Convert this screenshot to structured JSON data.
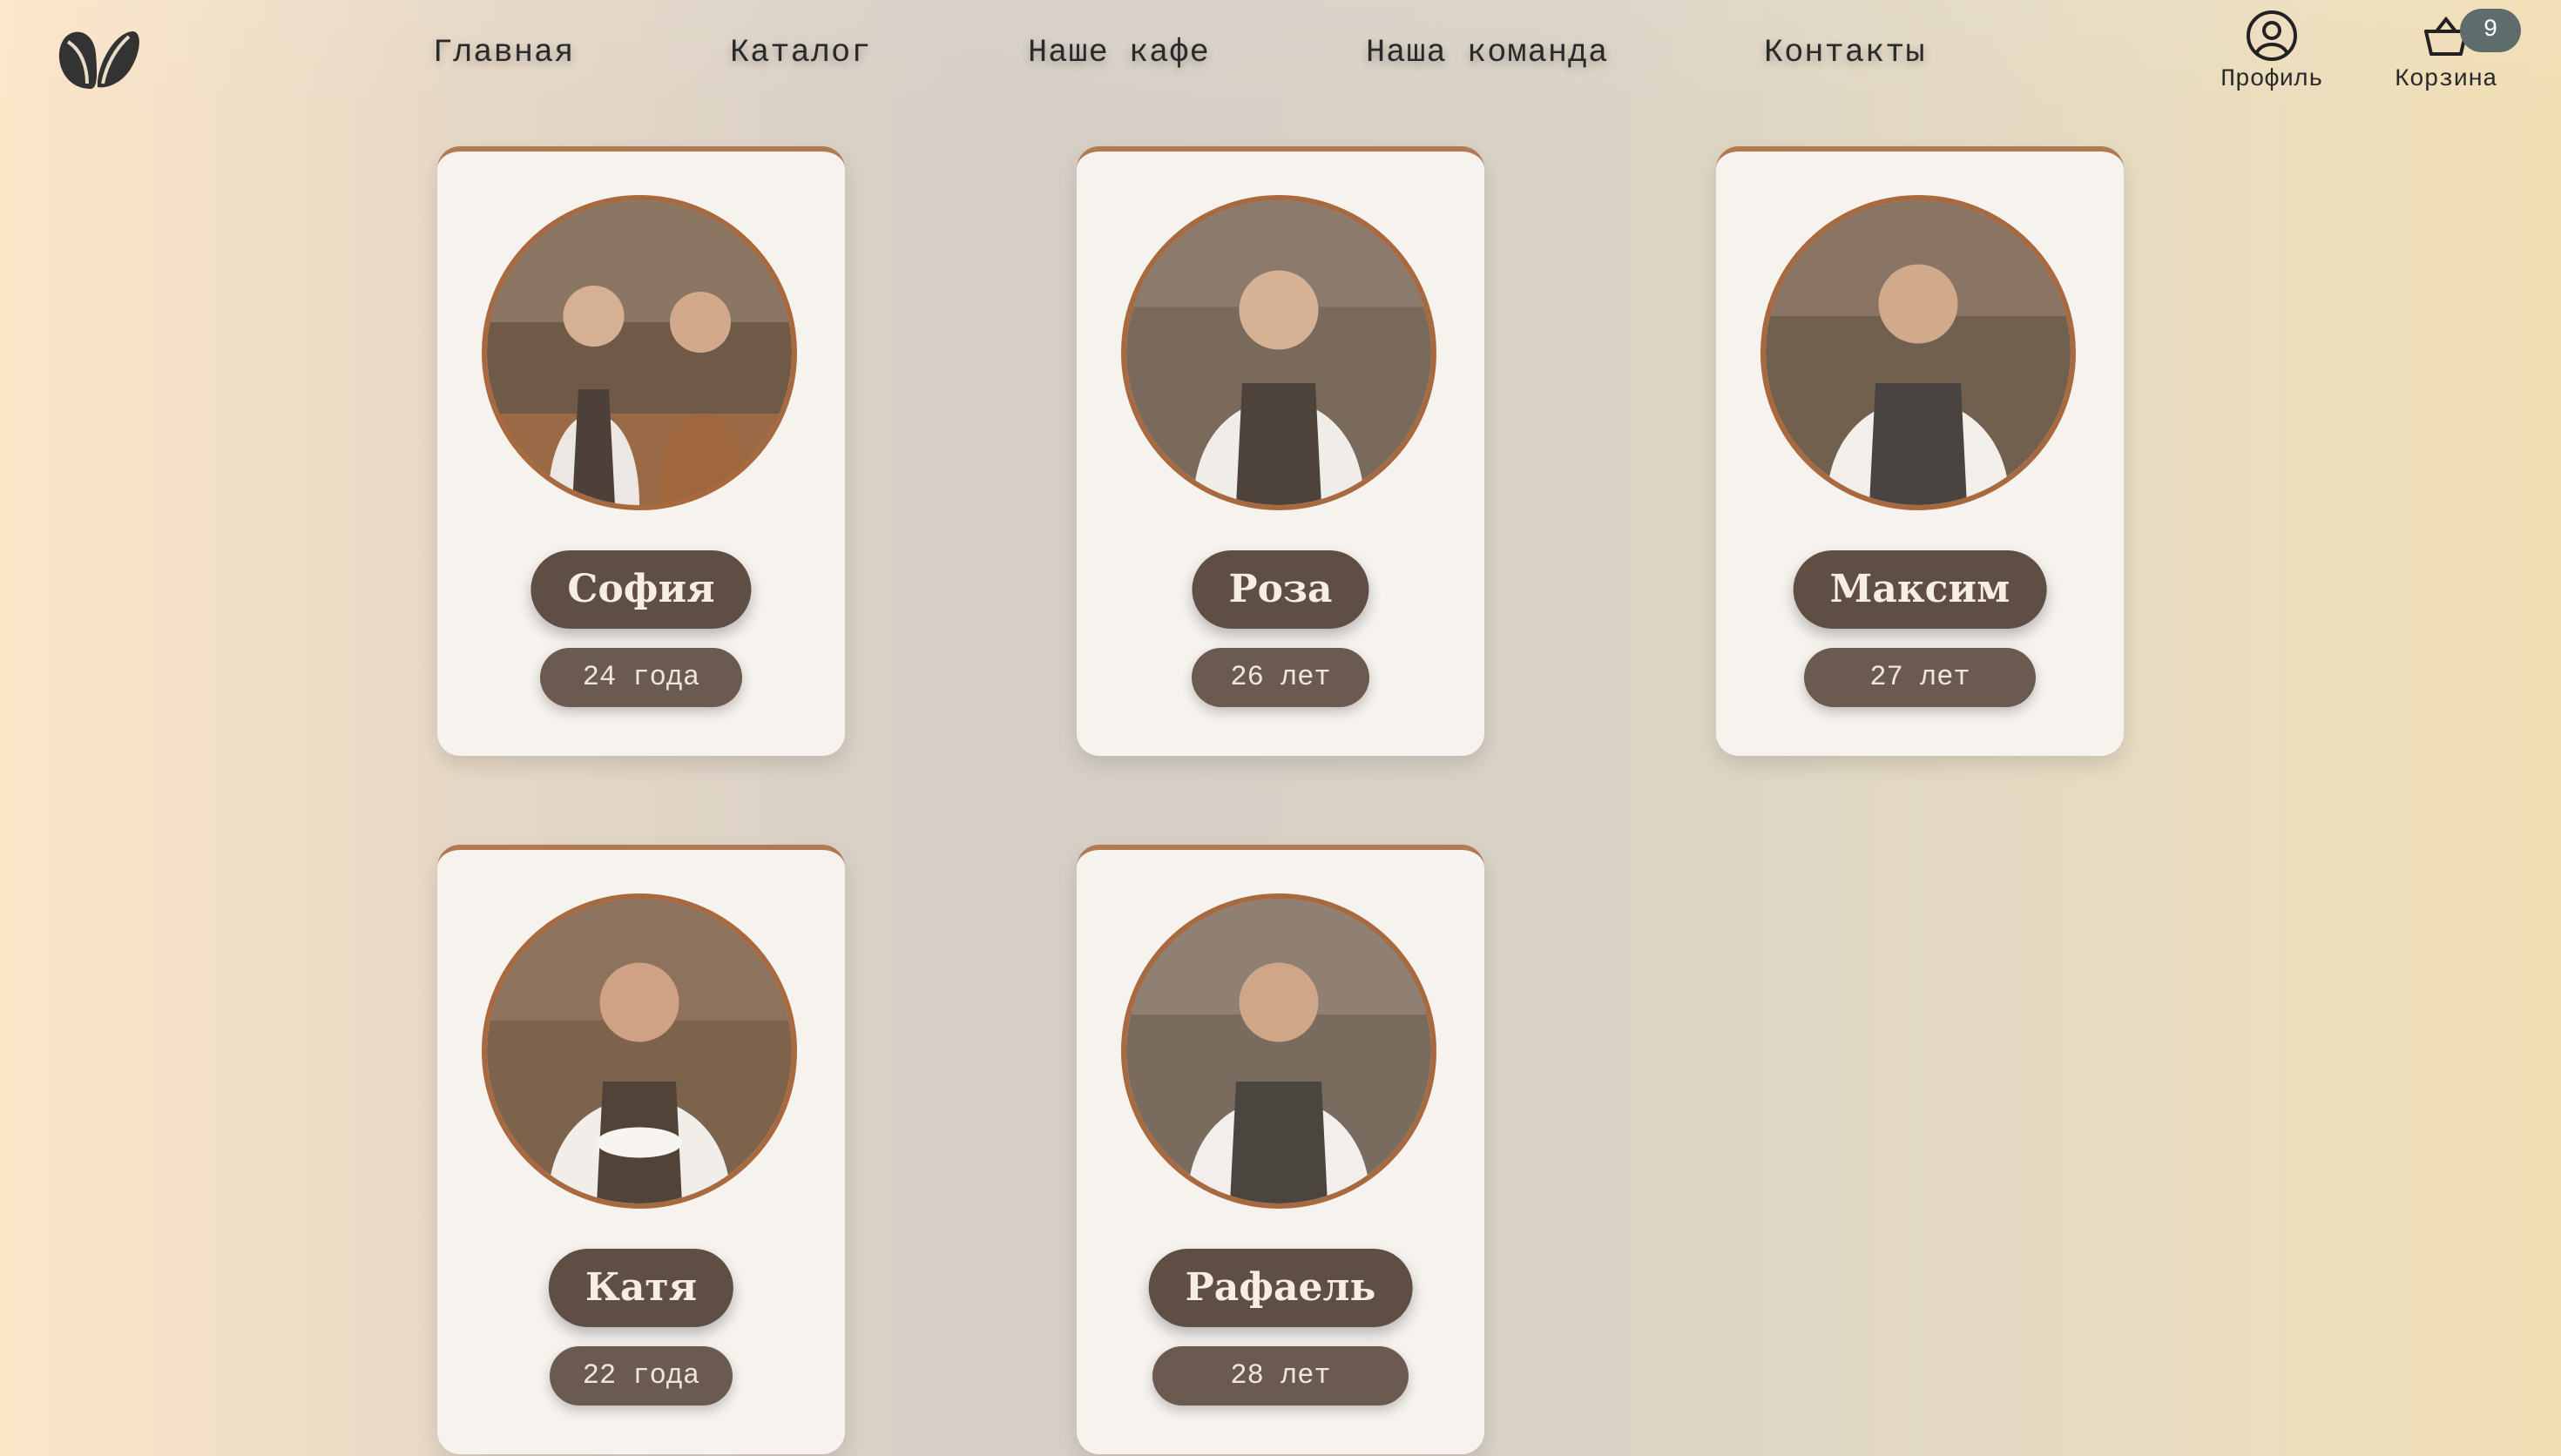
{
  "header": {
    "logo": "coffee-beans-logo",
    "nav": [
      {
        "label": "Главная"
      },
      {
        "label": "Каталог"
      },
      {
        "label": "Наше кафе"
      },
      {
        "label": "Наша команда"
      },
      {
        "label": "Контакты"
      }
    ],
    "profile_label": "Профиль",
    "cart_label": "Корзина",
    "cart_count": "9"
  },
  "team": [
    {
      "name": "София",
      "age": "24 года"
    },
    {
      "name": "Роза",
      "age": "26 лет"
    },
    {
      "name": "Максим",
      "age": "27 лет"
    },
    {
      "name": "Катя",
      "age": "22 года"
    },
    {
      "name": "Рафаель",
      "age": "28 лет"
    }
  ],
  "colors": {
    "accent": "#a8693f",
    "pill": "#5f4e44",
    "badge": "#5e6d6c"
  }
}
